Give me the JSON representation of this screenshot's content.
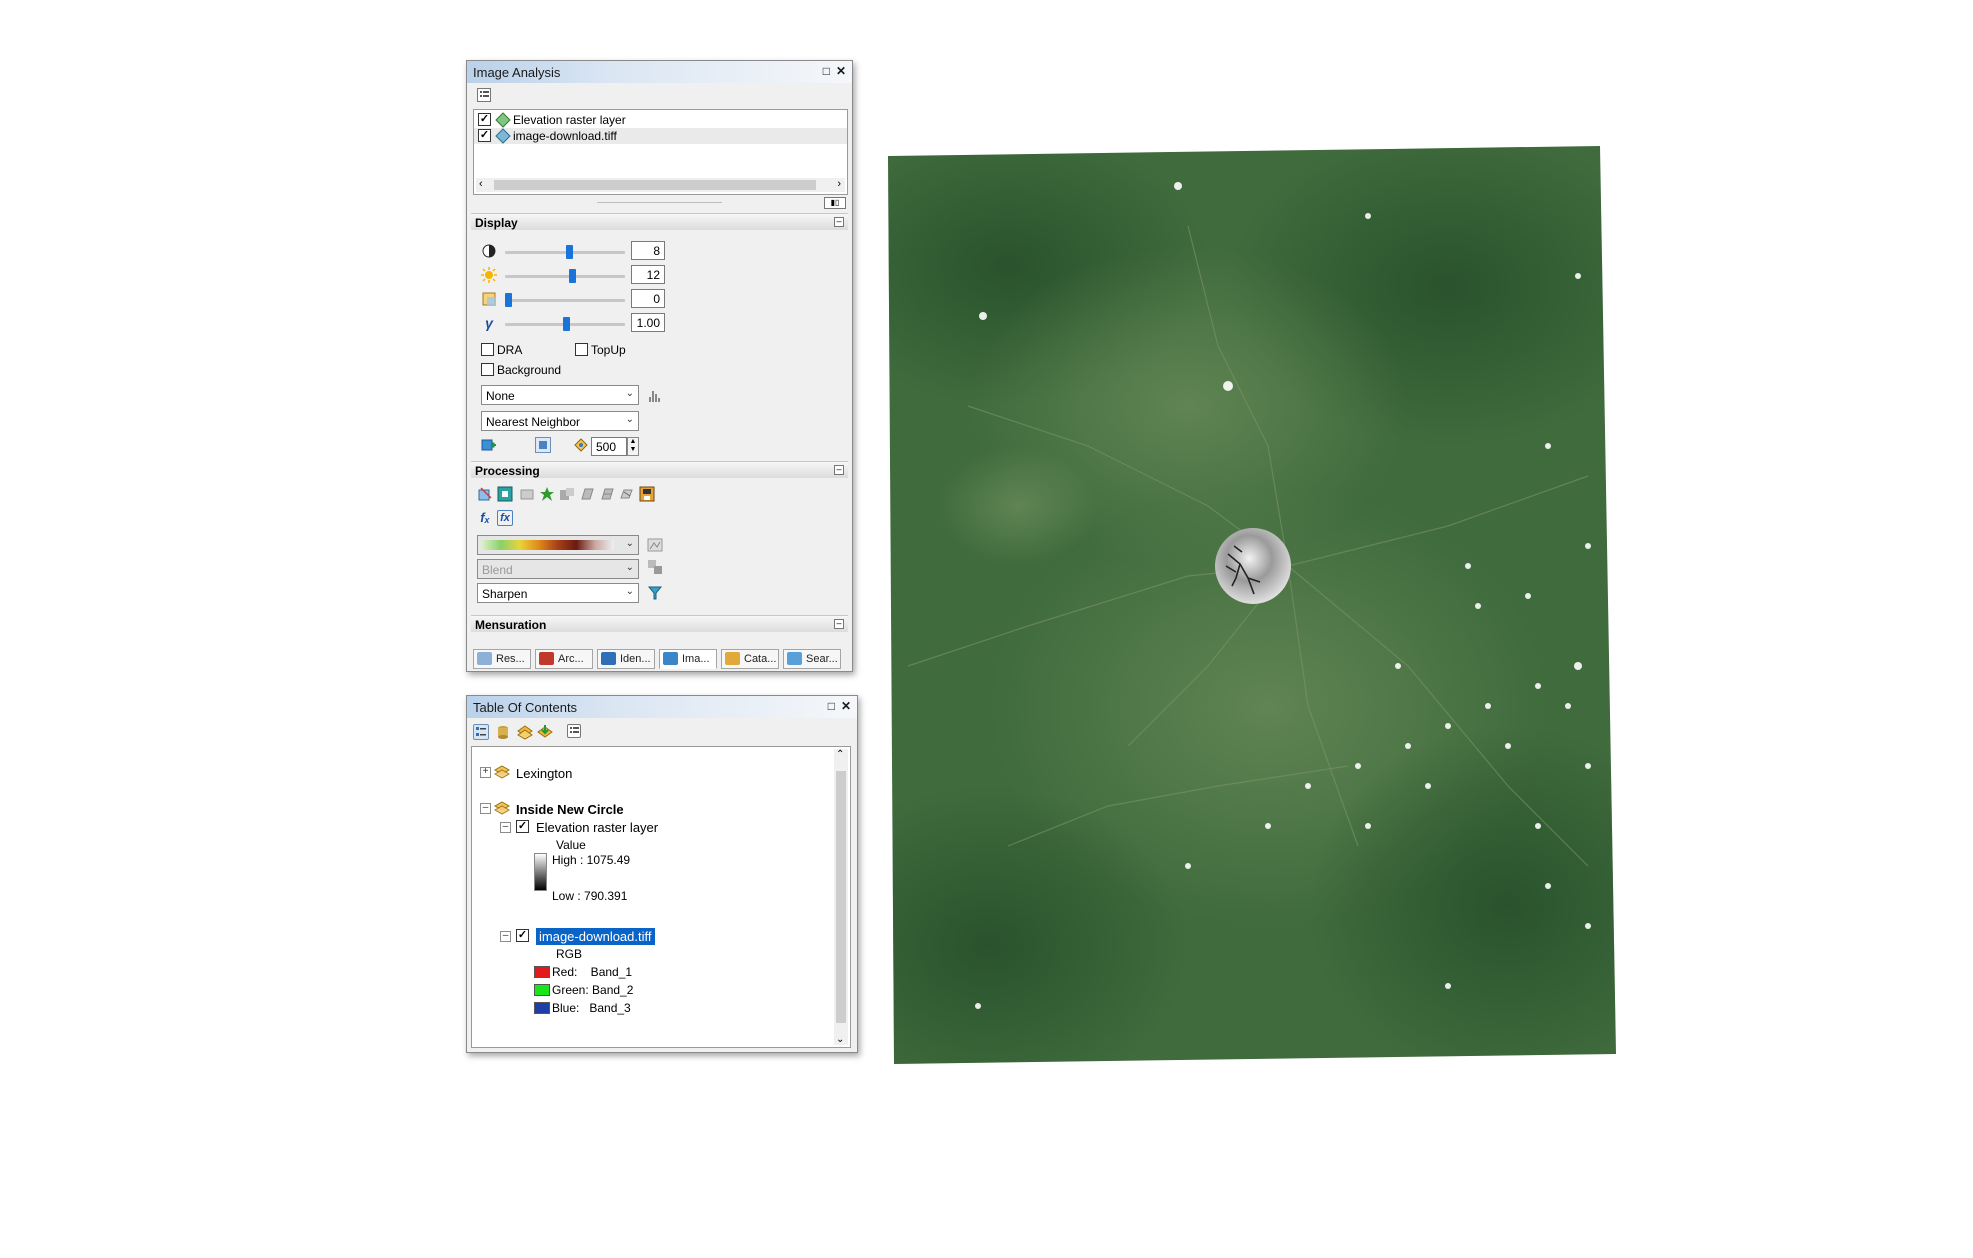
{
  "image_analysis": {
    "title": "Image Analysis",
    "layers": [
      {
        "label": "Elevation raster layer",
        "checked": true
      },
      {
        "label": "image-download.tiff",
        "checked": true
      }
    ],
    "display": {
      "header": "Display",
      "contrast_value": "8",
      "brightness_value": "12",
      "transparency_value": "0",
      "gamma_value": "1.00",
      "dra_label": "DRA",
      "topup_label": "TopUp",
      "background_label": "Background",
      "stretch_selected": "None",
      "resampling_selected": "Nearest Neighbor",
      "scale_value": "500"
    },
    "processing": {
      "header": "Processing",
      "blend_selected": "Blend",
      "sharpen_selected": "Sharpen"
    },
    "mensuration": {
      "header": "Mensuration"
    },
    "tabs": [
      "Res...",
      "Arc...",
      "Iden...",
      "Ima...",
      "Cata...",
      "Sear..."
    ]
  },
  "toc": {
    "title": "Table Of Contents",
    "group1": "Lexington",
    "group2": "Inside New Circle",
    "elev_layer": "Elevation raster layer",
    "elev_value_label": "Value",
    "elev_high": "High : 1075.49",
    "elev_low": "Low : 790.391",
    "image_layer": "image-download.tiff",
    "rgb_label": "RGB",
    "bands": [
      {
        "label": "Red:    Band_1",
        "color": "#e31a1c"
      },
      {
        "label": "Green: Band_2",
        "color": "#19e619"
      },
      {
        "label": "Blue:   Band_3",
        "color": "#1f3ea8"
      }
    ]
  },
  "colors": {
    "selection": "#0a64c8",
    "slider_thumb": "#1a73d9",
    "map_green": "#3e6a3c"
  }
}
